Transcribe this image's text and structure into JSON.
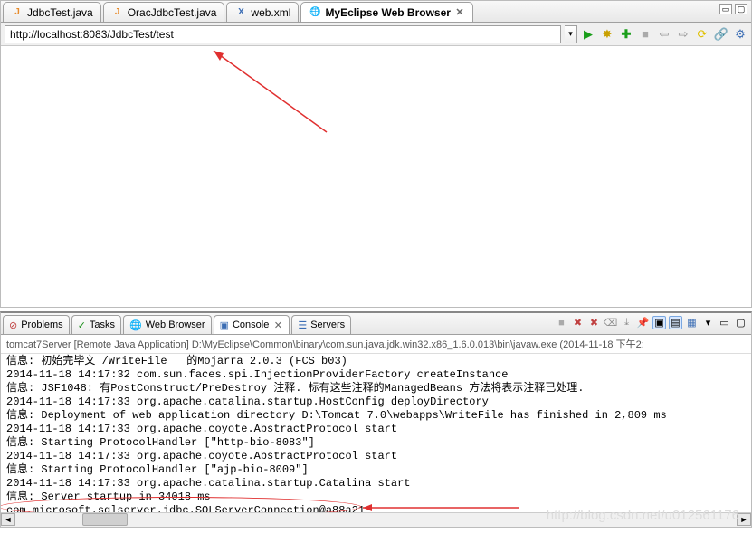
{
  "editor": {
    "tabs": [
      {
        "label": "JdbcTest.java",
        "icon": "J"
      },
      {
        "label": "OracJdbcTest.java",
        "icon": "J"
      },
      {
        "label": "web.xml",
        "icon": "X"
      },
      {
        "label": "MyEclipse Web Browser",
        "icon": "🌐",
        "active": true
      }
    ],
    "url": "http://localhost:8083/JdbcTest/test"
  },
  "bottom": {
    "tabs": [
      {
        "label": "Problems",
        "icon": "⊘"
      },
      {
        "label": "Tasks",
        "icon": "✓"
      },
      {
        "label": "Web Browser",
        "icon": "🌐"
      },
      {
        "label": "Console",
        "icon": "▣",
        "active": true
      },
      {
        "label": "Servers",
        "icon": "☰"
      }
    ],
    "process_line": "tomcat7Server [Remote Java Application] D:\\MyEclipse\\Common\\binary\\com.sun.java.jdk.win32.x86_1.6.0.013\\bin\\javaw.exe (2014-11-18 下午2:",
    "lines": [
      "信息: 初始完毕文 /WriteFile   的Mojarra 2.0.3 (FCS b03)",
      "2014-11-18 14:17:32 com.sun.faces.spi.InjectionProviderFactory createInstance",
      "信息: JSF1048: 有PostConstruct/PreDestroy 注释. 标有这些注释的ManagedBeans 方法将表示注释已处理.",
      "2014-11-18 14:17:33 org.apache.catalina.startup.HostConfig deployDirectory",
      "信息: Deployment of web application directory D:\\Tomcat 7.0\\webapps\\WriteFile has finished in 2,809 ms",
      "2014-11-18 14:17:33 org.apache.coyote.AbstractProtocol start",
      "信息: Starting ProtocolHandler [\"http-bio-8083\"]",
      "2014-11-18 14:17:33 org.apache.coyote.AbstractProtocol start",
      "信息: Starting ProtocolHandler [\"ajp-bio-8009\"]",
      "2014-11-18 14:17:33 org.apache.catalina.startup.Catalina start",
      "信息: Server startup in 34018 ms",
      "com.microsoft.sqlserver.jdbc.SQLServerConnection@a88a21"
    ]
  },
  "watermark": "http://blog.csdn.net/u012561176"
}
